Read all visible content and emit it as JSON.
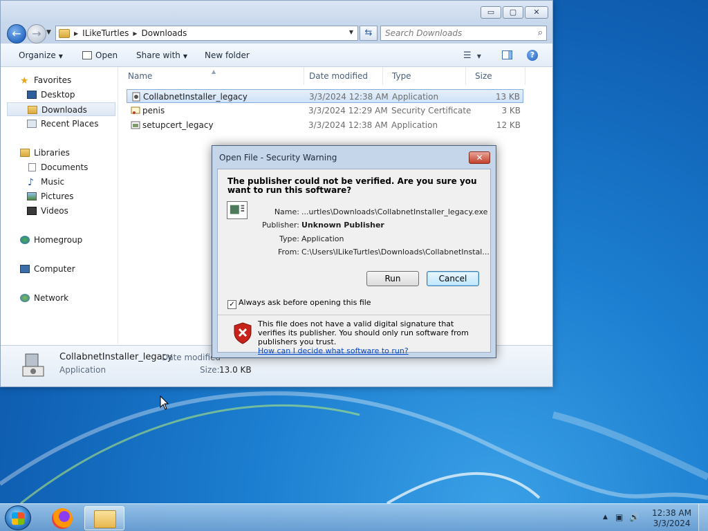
{
  "explorer": {
    "window_buttons": {
      "minimize": "▭",
      "maximize": "▢",
      "close": "✕"
    },
    "address": {
      "parts": [
        "ILikeTurtles",
        "Downloads"
      ]
    },
    "search": {
      "placeholder": "Search Downloads"
    },
    "toolbar": {
      "organize": "Organize",
      "open": "Open",
      "share_with": "Share with",
      "new_folder": "New folder"
    },
    "nav": {
      "favorites": "Favorites",
      "desktop": "Desktop",
      "downloads": "Downloads",
      "recent_places": "Recent Places",
      "libraries": "Libraries",
      "documents": "Documents",
      "music": "Music",
      "pictures": "Pictures",
      "videos": "Videos",
      "homegroup": "Homegroup",
      "computer": "Computer",
      "network": "Network"
    },
    "columns": [
      "Name",
      "Date modified",
      "Type",
      "Size"
    ],
    "files": [
      {
        "name": "CollabnetInstaller_legacy",
        "date": "3/3/2024 12:38 AM",
        "type": "Application",
        "size": "13 KB",
        "icon": "app-icon",
        "selected": true
      },
      {
        "name": "penis",
        "date": "3/3/2024 12:29 AM",
        "type": "Security Certificate",
        "size": "3 KB",
        "icon": "certificate-icon",
        "selected": false
      },
      {
        "name": "setupcert_legacy",
        "date": "3/3/2024 12:38 AM",
        "type": "Application",
        "size": "12 KB",
        "icon": "app-icon",
        "selected": false
      }
    ],
    "details": {
      "name": "CollabnetInstaller_legacy",
      "date_label": "Date modified",
      "type": "Application",
      "size_label": "Size:",
      "size": "13.0 KB"
    }
  },
  "dialog": {
    "title": "Open File - Security Warning",
    "question": "The publisher could not be verified.  Are you sure you want to run this software?",
    "fields": [
      {
        "label": "Name:",
        "value": "...urtles\\Downloads\\CollabnetInstaller_legacy.exe",
        "bold": false
      },
      {
        "label": "Publisher:",
        "value": "Unknown Publisher",
        "bold": true
      },
      {
        "label": "Type:",
        "value": "Application",
        "bold": false
      },
      {
        "label": "From:",
        "value": "C:\\Users\\ILikeTurtles\\Downloads\\CollabnetInstal...",
        "bold": false
      }
    ],
    "run_label": "Run",
    "cancel_label": "Cancel",
    "checkbox_label": "Always ask before opening this file",
    "checkbox_checked": true,
    "warning_text": "This file does not have a valid digital signature that verifies its publisher.  You should only run software from publishers you trust.",
    "link_text": "How can I decide what software to run?"
  },
  "taskbar": {
    "time": "12:38 AM",
    "date": "3/3/2024"
  },
  "colors": {
    "selection_border": "#84acdd",
    "link": "#0645c8",
    "close_red": "#c2402d"
  }
}
